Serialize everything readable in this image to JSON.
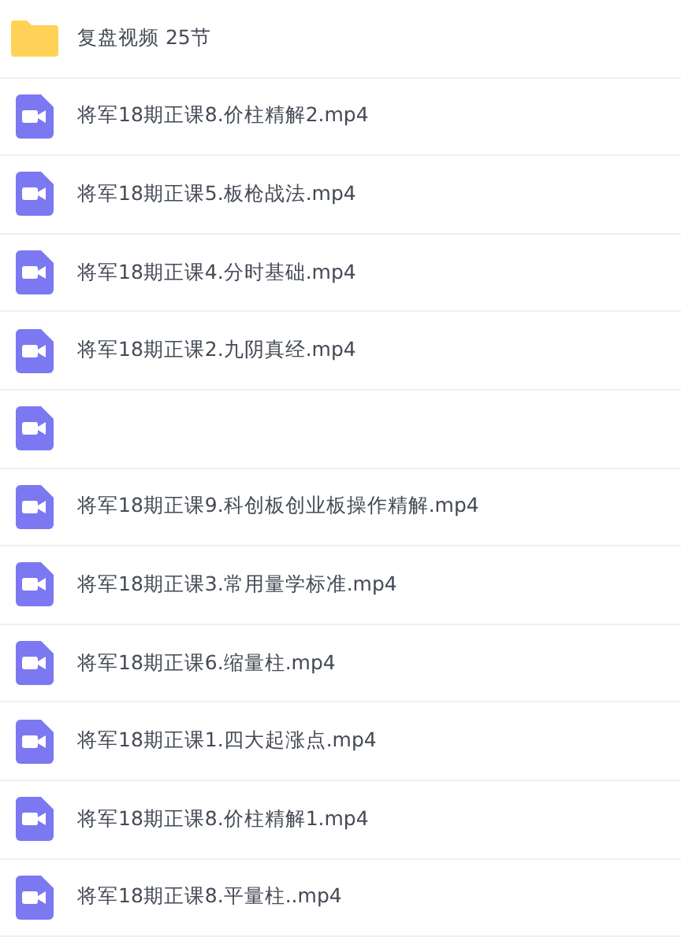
{
  "files": [
    {
      "kind": "folder",
      "name": "复盘视频 25节"
    },
    {
      "kind": "video",
      "name": "将军18期正课8.价柱精解2.mp4"
    },
    {
      "kind": "video",
      "name": "将军18期正课5.板枪战法.mp4"
    },
    {
      "kind": "video",
      "name": "将军18期正课4.分时基础.mp4"
    },
    {
      "kind": "video",
      "name": "将军18期正课2.九阴真经.mp4"
    },
    {
      "kind": "video"
    },
    {
      "kind": "video",
      "name": "将军18期正课9.科创板创业板操作精解.mp4"
    },
    {
      "kind": "video",
      "name": "将军18期正课3.常用量学标准.mp4"
    },
    {
      "kind": "video",
      "name": "将军18期正课6.缩量柱.mp4"
    },
    {
      "kind": "video",
      "name": "将军18期正课1.四大起涨点.mp4"
    },
    {
      "kind": "video",
      "name": "将军18期正课8.价柱精解1.mp4"
    },
    {
      "kind": "video",
      "name": "将军18期正课8.平量柱..mp4"
    }
  ]
}
